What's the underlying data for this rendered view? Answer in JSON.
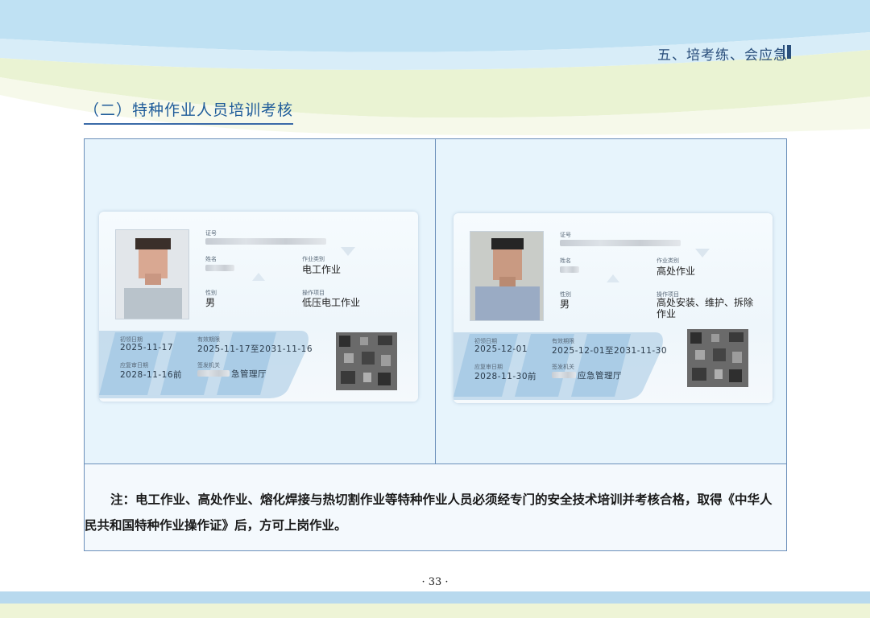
{
  "header": {
    "chapter": "五、培考练、会应急"
  },
  "section": {
    "title": "（二）特种作业人员培训考核"
  },
  "cards": [
    {
      "labels": {
        "cert_no": "证号",
        "name": "姓名",
        "gender": "性别",
        "category": "作业类别",
        "item": "操作项目",
        "issue_date": "初领日期",
        "valid_period": "有效期限",
        "review_date": "应复审日期",
        "authority": "签发机关"
      },
      "gender": "男",
      "category": "电工作业",
      "item": "低压电工作业",
      "issue_date": "2025-11-17",
      "valid_period": "2025-11-17至2031-11-16",
      "review_date": "2028-11-16前",
      "authority": "急管理厅"
    },
    {
      "labels": {
        "cert_no": "证号",
        "name": "姓名",
        "gender": "性别",
        "category": "作业类别",
        "item": "操作项目",
        "issue_date": "初领日期",
        "valid_period": "有效期限",
        "review_date": "应复审日期",
        "authority": "签发机关"
      },
      "gender": "男",
      "category": "高处作业",
      "item": "高处安装、维护、拆除作业",
      "issue_date": "2025-12-01",
      "valid_period": "2025-12-01至2031-11-30",
      "review_date": "2028-11-30前",
      "authority": "应急管理厅"
    }
  ],
  "note": "注：电工作业、高处作业、熔化焊接与热切割作业等特种作业人员必须经专门的安全技术培训并考核合格，取得《中华人民共和国特种作业操作证》后，方可上岗作业。",
  "page_number": "· 33 ·",
  "colors": {
    "accent": "#1f5c9a",
    "frame": "#6b8fba",
    "cell_bg": "#e7f4fc",
    "band_blue": "#b8d9ee",
    "band_green": "#eef4d6"
  }
}
